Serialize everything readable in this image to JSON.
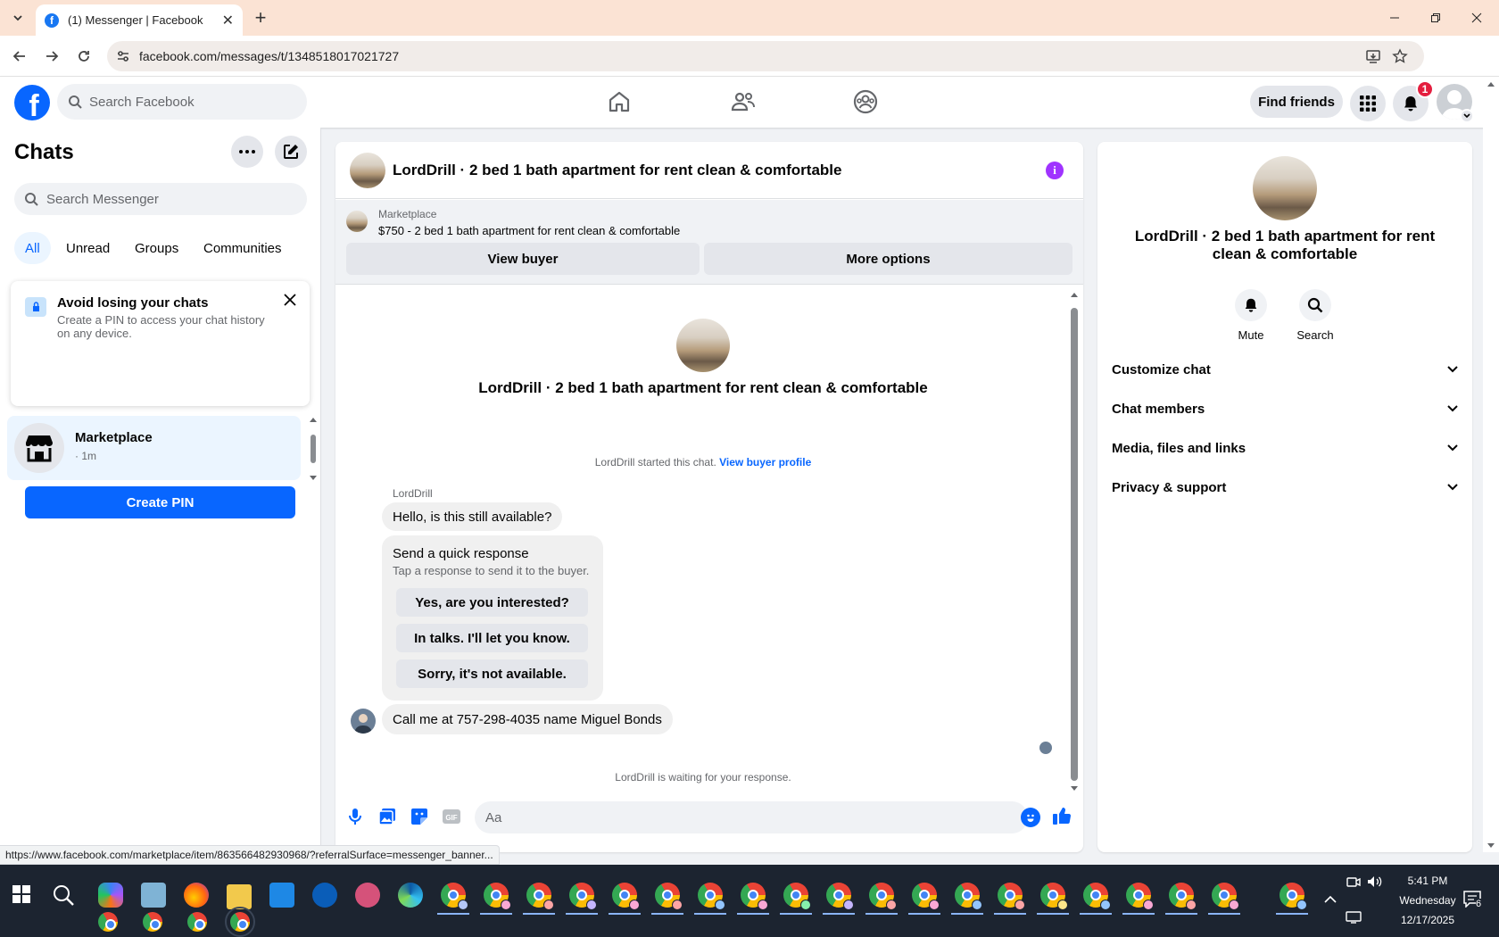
{
  "browser": {
    "tab_title": "(1) Messenger | Facebook",
    "url": "facebook.com/messages/t/1348518017021727",
    "status_url": "https://www.facebook.com/marketplace/item/863566482930968/?referralSurface=messenger_banner..."
  },
  "fb_header": {
    "search_placeholder": "Search Facebook",
    "find_friends_label": "Find friends",
    "notification_count": "1",
    "nav": [
      "home-icon",
      "friends-icon",
      "groups-icon"
    ]
  },
  "chats": {
    "title": "Chats",
    "search_placeholder": "Search Messenger",
    "filters": [
      {
        "label": "All",
        "active": true
      },
      {
        "label": "Unread",
        "active": false
      },
      {
        "label": "Groups",
        "active": false
      },
      {
        "label": "Communities",
        "active": false
      }
    ],
    "pin_card": {
      "title": "Avoid losing your chats",
      "text": "Create a PIN to access your chat history on any device.",
      "button": "Create PIN"
    },
    "items": [
      {
        "name": "Marketplace",
        "time": "· 1m"
      }
    ]
  },
  "conversation": {
    "title": "LordDrill · 2 bed 1 bath apartment for rent clean & comfortable",
    "marketplace_label": "Marketplace",
    "listing": "$750 - 2 bed 1 bath apartment for rent clean & comfortable",
    "view_buyer_label": "View buyer",
    "more_options_label": "More options",
    "started_text": "LordDrill started this chat.",
    "view_buyer_profile": "View buyer profile",
    "sender_name": "LordDrill",
    "message_1": "Hello, is this still available?",
    "quick_response_title": "Send a quick response",
    "quick_response_subtitle": "Tap a response to send it to the buyer.",
    "quick_responses": [
      "Yes, are you interested?",
      "In talks. I'll let you know.",
      "Sorry, it's not available."
    ],
    "message_2": "Call me at 757-298-4035 name Miguel Bonds",
    "waiting_text": "LordDrill is waiting for your response.",
    "composer_placeholder": "Aa"
  },
  "details": {
    "title": "LordDrill · 2 bed 1 bath apartment for rent clean & comfortable",
    "mute_label": "Mute",
    "search_label": "Search",
    "sections": [
      "Customize chat",
      "Chat members",
      "Media, files and links",
      "Privacy & support"
    ]
  },
  "taskbar": {
    "time": "5:41 PM",
    "day": "Wednesday",
    "date": "12/17/2025",
    "notification_count": "6"
  },
  "colors": {
    "accent": "#0866ff",
    "info": "#a033ff",
    "badge": "#e41e3f",
    "tab_strip": "#fbe3d4"
  }
}
